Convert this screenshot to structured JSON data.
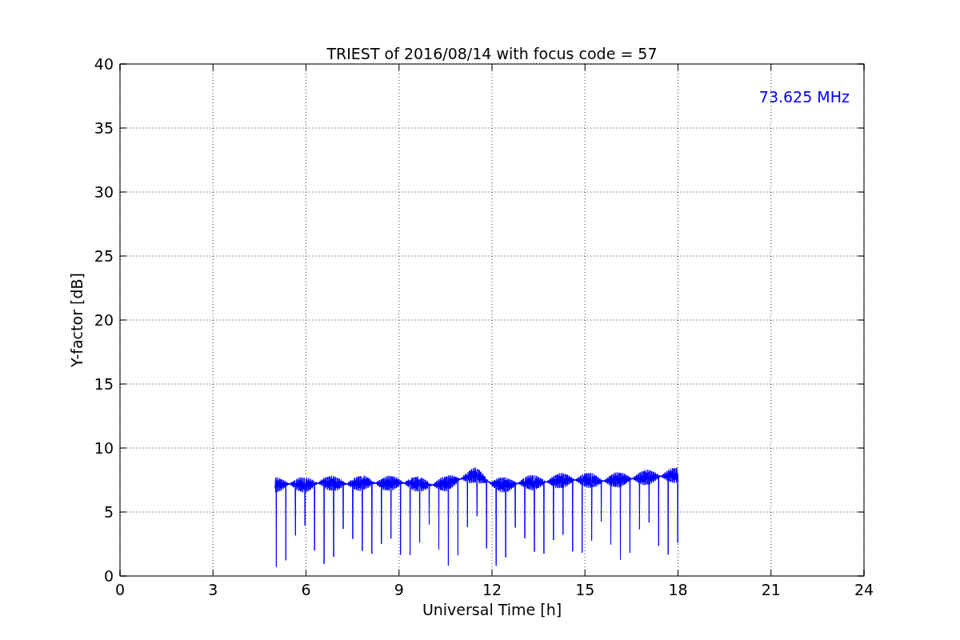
{
  "chart_data": {
    "type": "line",
    "title": "TRIEST of 2016/08/14 with focus code = 57",
    "xlabel": "Universal Time [h]",
    "ylabel": "Y-factor [dB]",
    "x": [
      5,
      5.5,
      6,
      6.5,
      7,
      7.5,
      8,
      8.5,
      9,
      9.5,
      10,
      10.5,
      11,
      11.5,
      12,
      12.5,
      13,
      13.5,
      14,
      14.5,
      15,
      15.5,
      16,
      16.5,
      17,
      17.5,
      18
    ],
    "series": [
      {
        "name": "73.625 MHz",
        "color": "#0000ff",
        "values": [
          7.1,
          7.2,
          7.1,
          7.3,
          7.2,
          7.2,
          7.3,
          7.2,
          7.3,
          7.2,
          7.1,
          7.2,
          7.6,
          7.9,
          7.2,
          7.1,
          7.3,
          7.3,
          7.4,
          7.5,
          7.5,
          7.4,
          7.5,
          7.6,
          7.7,
          7.8,
          7.9
        ]
      }
    ],
    "xlim": [
      0,
      24
    ],
    "ylim": [
      0,
      40
    ],
    "xticks": [
      0,
      3,
      6,
      9,
      12,
      15,
      18,
      21,
      24
    ],
    "yticks": [
      0,
      5,
      10,
      15,
      20,
      25,
      30,
      35,
      40
    ],
    "grid": true
  }
}
